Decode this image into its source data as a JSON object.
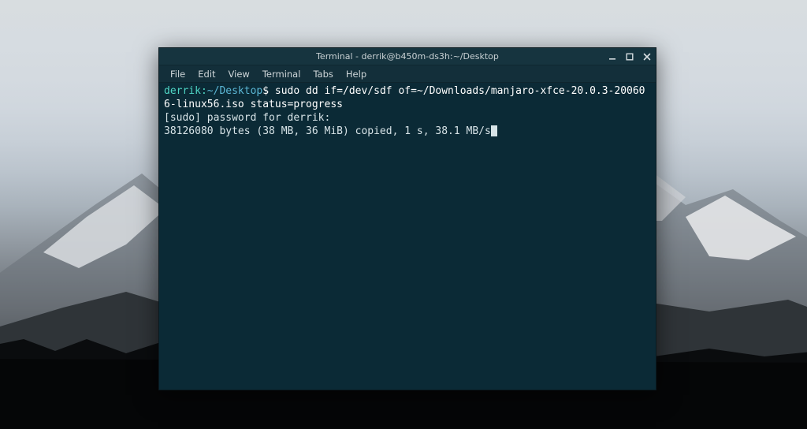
{
  "window": {
    "title": "Terminal - derrik@b450m-ds3h:~/Desktop"
  },
  "menubar": {
    "file": "File",
    "edit": "Edit",
    "view": "View",
    "terminal": "Terminal",
    "tabs": "Tabs",
    "help": "Help"
  },
  "terminal": {
    "prompt_user_host": "derrik:",
    "prompt_path": "~/Desktop",
    "prompt_suffix": "$ ",
    "command": "sudo dd if=/dev/sdf of=~/Downloads/manjaro-xfce-20.0.3-200606-linux56.iso status=progress",
    "output_line1": "[sudo] password for derrik:",
    "output_line2": "38126080 bytes (38 MB, 36 MiB) copied, 1 s, 38.1 MB/s"
  }
}
